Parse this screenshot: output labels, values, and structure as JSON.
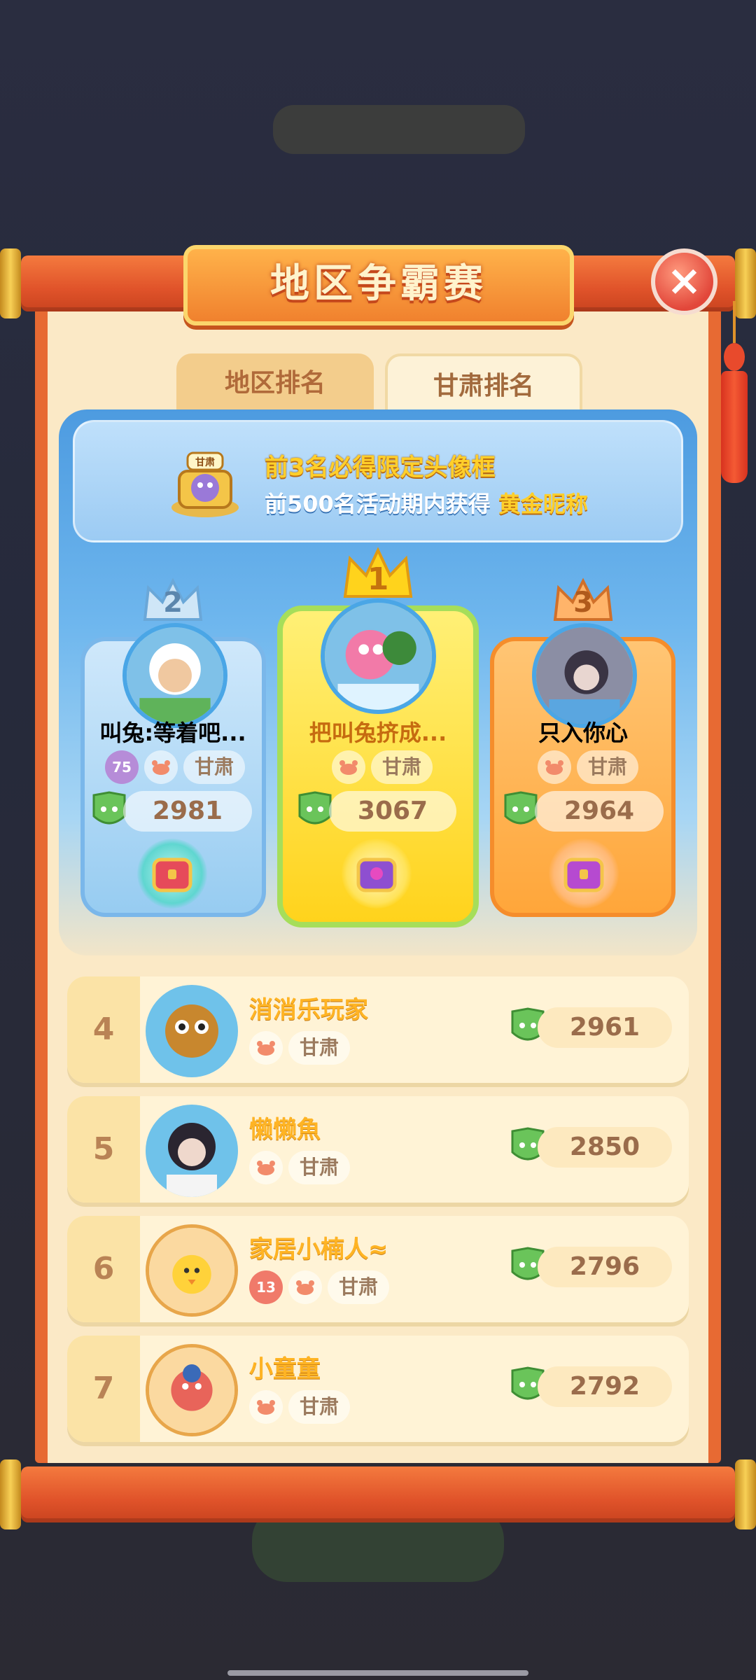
{
  "title": "地区争霸赛",
  "tabs": [
    {
      "label": "地区排名",
      "active": false
    },
    {
      "label": "甘肃排名",
      "active": true
    }
  ],
  "banner": {
    "badge_text": "甘肃",
    "line1": "前3名必得限定头像框",
    "line2_prefix": "前500名活动期内获得 ",
    "line2_highlight": "黄金昵称"
  },
  "podium": [
    {
      "rank": "2",
      "name": "叫兔:等着吧...",
      "level": "75",
      "region": "甘肃",
      "score": "2981"
    },
    {
      "rank": "1",
      "name": "把叫兔挤成...",
      "region": "甘肃",
      "score": "3067"
    },
    {
      "rank": "3",
      "name": "只入你心",
      "region": "甘肃",
      "score": "2964"
    }
  ],
  "rows": [
    {
      "rank": "4",
      "name": "消消乐玩家",
      "region": "甘肃",
      "score": "2961"
    },
    {
      "rank": "5",
      "name": "懒懒魚",
      "region": "甘肃",
      "score": "2850"
    },
    {
      "rank": "6",
      "name": "家居小楠人≈",
      "level": "13",
      "region": "甘肃",
      "score": "2796"
    },
    {
      "rank": "7",
      "name": "小童童",
      "region": "甘肃",
      "score": "2792"
    }
  ],
  "icons": {
    "close": "close-icon",
    "score": "trophy-leaf-icon",
    "tag": "crab-badge-icon",
    "chest": "treasure-chest-icon",
    "crown": "crown-icon"
  },
  "colors": {
    "scroll_red": "#e76a33",
    "paper": "#fbe9c6",
    "gold_text": "#ffcf2a",
    "blue_panel": "#4d9be0"
  }
}
